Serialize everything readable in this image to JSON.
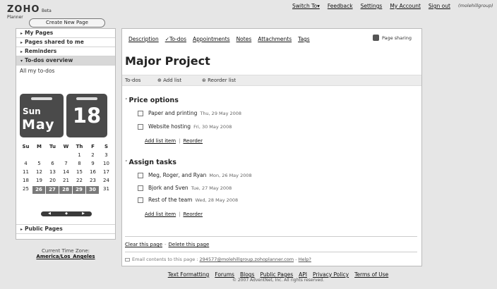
{
  "app": {
    "logo": "ZOHO",
    "logo_suffix": "Beta",
    "product": "Planner"
  },
  "create_button": "Create New Page",
  "topnav": {
    "switch_to": "Switch To",
    "feedback": "Feedback",
    "settings": "Settings",
    "my_account": "My Account",
    "sign_out": "Sign out",
    "user": "(molehillgroup)"
  },
  "sidebar": {
    "items": [
      {
        "label": "My Pages"
      },
      {
        "label": "Pages shared to me"
      },
      {
        "label": "Reminders"
      },
      {
        "label": "To-dos overview"
      }
    ],
    "caption": "All my to-dos",
    "public_pages": "Public Pages"
  },
  "calendar": {
    "day_name": "Sun",
    "month": "May",
    "day": "18",
    "weekdays": [
      "Su",
      "M",
      "Tu",
      "W",
      "Th",
      "F",
      "S"
    ],
    "weeks": [
      [
        "",
        "",
        "",
        "",
        "1",
        "2",
        "3"
      ],
      [
        "4",
        "5",
        "6",
        "7",
        "8",
        "9",
        "10"
      ],
      [
        "11",
        "12",
        "13",
        "14",
        "15",
        "16",
        "17"
      ],
      [
        "18",
        "19",
        "20",
        "21",
        "22",
        "23",
        "24"
      ],
      [
        "25",
        "26",
        "27",
        "28",
        "29",
        "30",
        "31"
      ]
    ],
    "highlighted_days": [
      "26",
      "27",
      "28",
      "29",
      "30"
    ]
  },
  "timezone": {
    "label": "Current Time Zone:",
    "value": "America/Los_Angeles"
  },
  "main": {
    "tabs": [
      "Description",
      "To-dos",
      "Appointments",
      "Notes",
      "Attachments",
      "Tags"
    ],
    "active_tab": "To-dos",
    "page_sharing": "Page sharing",
    "title": "Major Project",
    "todo_bar": {
      "label": "To-dos",
      "add_list": "Add list",
      "reorder_list": "Reorder list"
    },
    "lists": [
      {
        "title": "Price options",
        "items": [
          {
            "label": "Paper and printing",
            "date": "Thu, 29 May 2008"
          },
          {
            "label": "Website hosting",
            "date": "Fri, 30 May 2008"
          }
        ]
      },
      {
        "title": "Assign tasks",
        "items": [
          {
            "label": "Meg, Roger, and Ryan",
            "date": "Mon, 26 May 2008"
          },
          {
            "label": "Bjork and Sven",
            "date": "Tue, 27 May 2008"
          },
          {
            "label": "Rest of the team",
            "date": "Wed, 28 May 2008"
          }
        ]
      }
    ],
    "add_list_item": "Add list item",
    "reorder": "Reorder",
    "clear_page": "Clear this page",
    "delete_page": "Delete this page",
    "email_label": "Email contents to this page :",
    "email_address": "294577@molehillgroup.zohoplanner.com",
    "help": "Help?"
  },
  "footer": {
    "links": [
      "Text Formatting",
      "Forums",
      "Blogs",
      "Public Pages",
      "API",
      "Privacy Policy",
      "Terms of Use"
    ],
    "copyright": "© 2007 AdventNet, Inc. All rights reserved."
  }
}
